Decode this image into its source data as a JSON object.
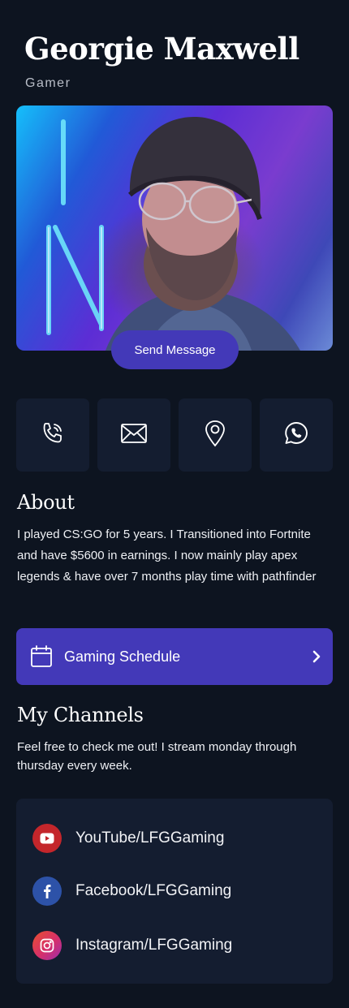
{
  "profile": {
    "name": "Georgie Maxwell",
    "role": "Gamer",
    "photo_icon": "profile-photo"
  },
  "actions": {
    "send_message": "Send Message"
  },
  "contact_icons": [
    "phone-icon",
    "mail-icon",
    "location-pin-icon",
    "whatsapp-icon"
  ],
  "about": {
    "title": "About",
    "text": "I played CS:GO for 5 years. I Transitioned into Fortnite and have $5600 in earnings. I now mainly play apex legends & have over 7 months play time with pathfinder"
  },
  "schedule": {
    "label": "Gaming Schedule",
    "icon": "calendar-icon"
  },
  "channels": {
    "title": "My Channels",
    "text": "Feel free to check me out! I stream monday through thursday every week.",
    "items": [
      {
        "label": "YouTube/LFGGaming",
        "icon": "youtube-icon",
        "color": "#c4262b"
      },
      {
        "label": "Facebook/LFGGaming",
        "icon": "facebook-icon",
        "color": "#2d52a8"
      },
      {
        "label": "Instagram/LFGGaming",
        "icon": "instagram-icon",
        "color": "#d62f6b"
      }
    ]
  },
  "colors": {
    "background": "#0d1420",
    "card": "#141d30",
    "accent": "#4339b8"
  }
}
